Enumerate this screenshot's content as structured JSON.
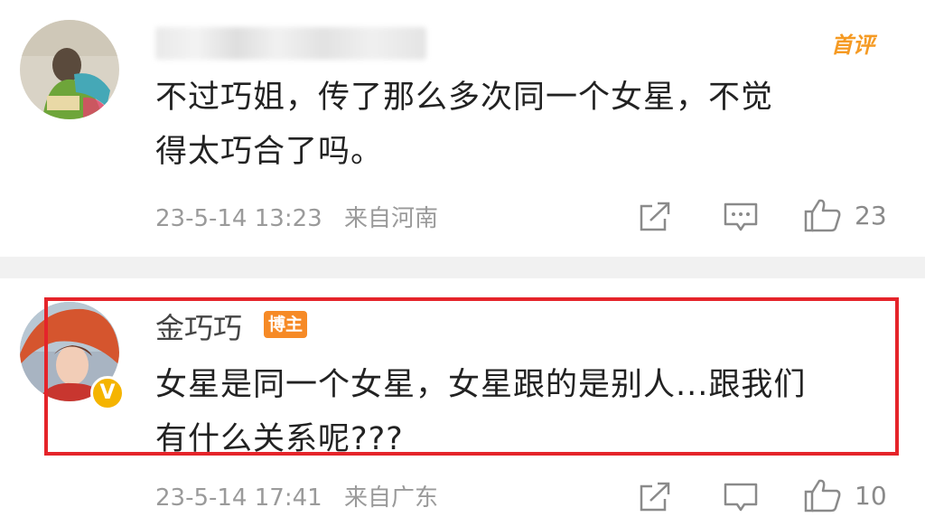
{
  "comments": [
    {
      "author": "",
      "first_badge": "首评",
      "text_lines": [
        "不过巧姐，传了那么多次同一个女星，不觉",
        "得太巧合了吗。"
      ],
      "time": "23-5-14 13:23",
      "location": "来自河南",
      "likes": "23"
    },
    {
      "author": "金巧巧",
      "author_badge": "博主",
      "verified_badge": "V",
      "text_lines": [
        "女星是同一个女星，女星跟的是别人...跟我们",
        "有什么关系呢???"
      ],
      "time": "23-5-14 17:41",
      "location": "来自广东",
      "likes": "10"
    }
  ],
  "icons": [
    "repost-icon",
    "comment-icon",
    "like-icon"
  ],
  "colors": {
    "highlight_border": "#e5242a",
    "badge_orange": "#f68a26",
    "first_badge": "#f59a23",
    "verified": "#f5b400"
  }
}
